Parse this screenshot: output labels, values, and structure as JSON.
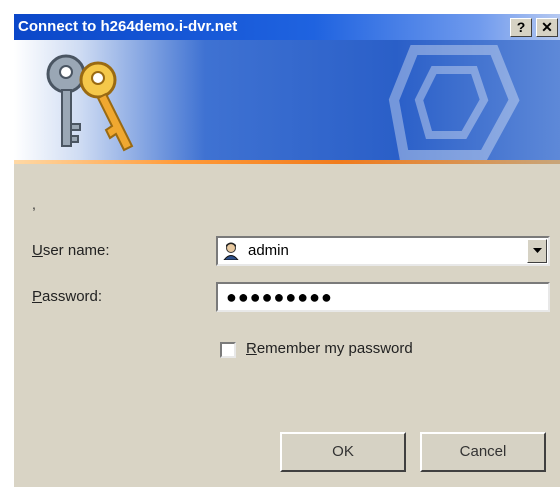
{
  "window": {
    "title": "Connect to h264demo.i-dvr.net",
    "help_label": "?",
    "close_label": "✕"
  },
  "form": {
    "separator_mark": ",",
    "user_label_accel": "U",
    "user_label_rest": "ser name:",
    "user_value": "admin",
    "password_label_accel": "P",
    "password_label_rest": "assword:",
    "password_value": "●●●●●●●●●",
    "remember_accel": "R",
    "remember_rest": "emember my password",
    "remember_checked": false
  },
  "buttons": {
    "ok": "OK",
    "cancel": "Cancel"
  },
  "icons": {
    "banner": "keys-icon",
    "user": "user-icon",
    "dropdown": "chevron-down-icon"
  },
  "colors": {
    "titlebar": "#1f63e0",
    "accent_line": "#f07b1d",
    "dialog_bg": "#d9d4c5"
  }
}
